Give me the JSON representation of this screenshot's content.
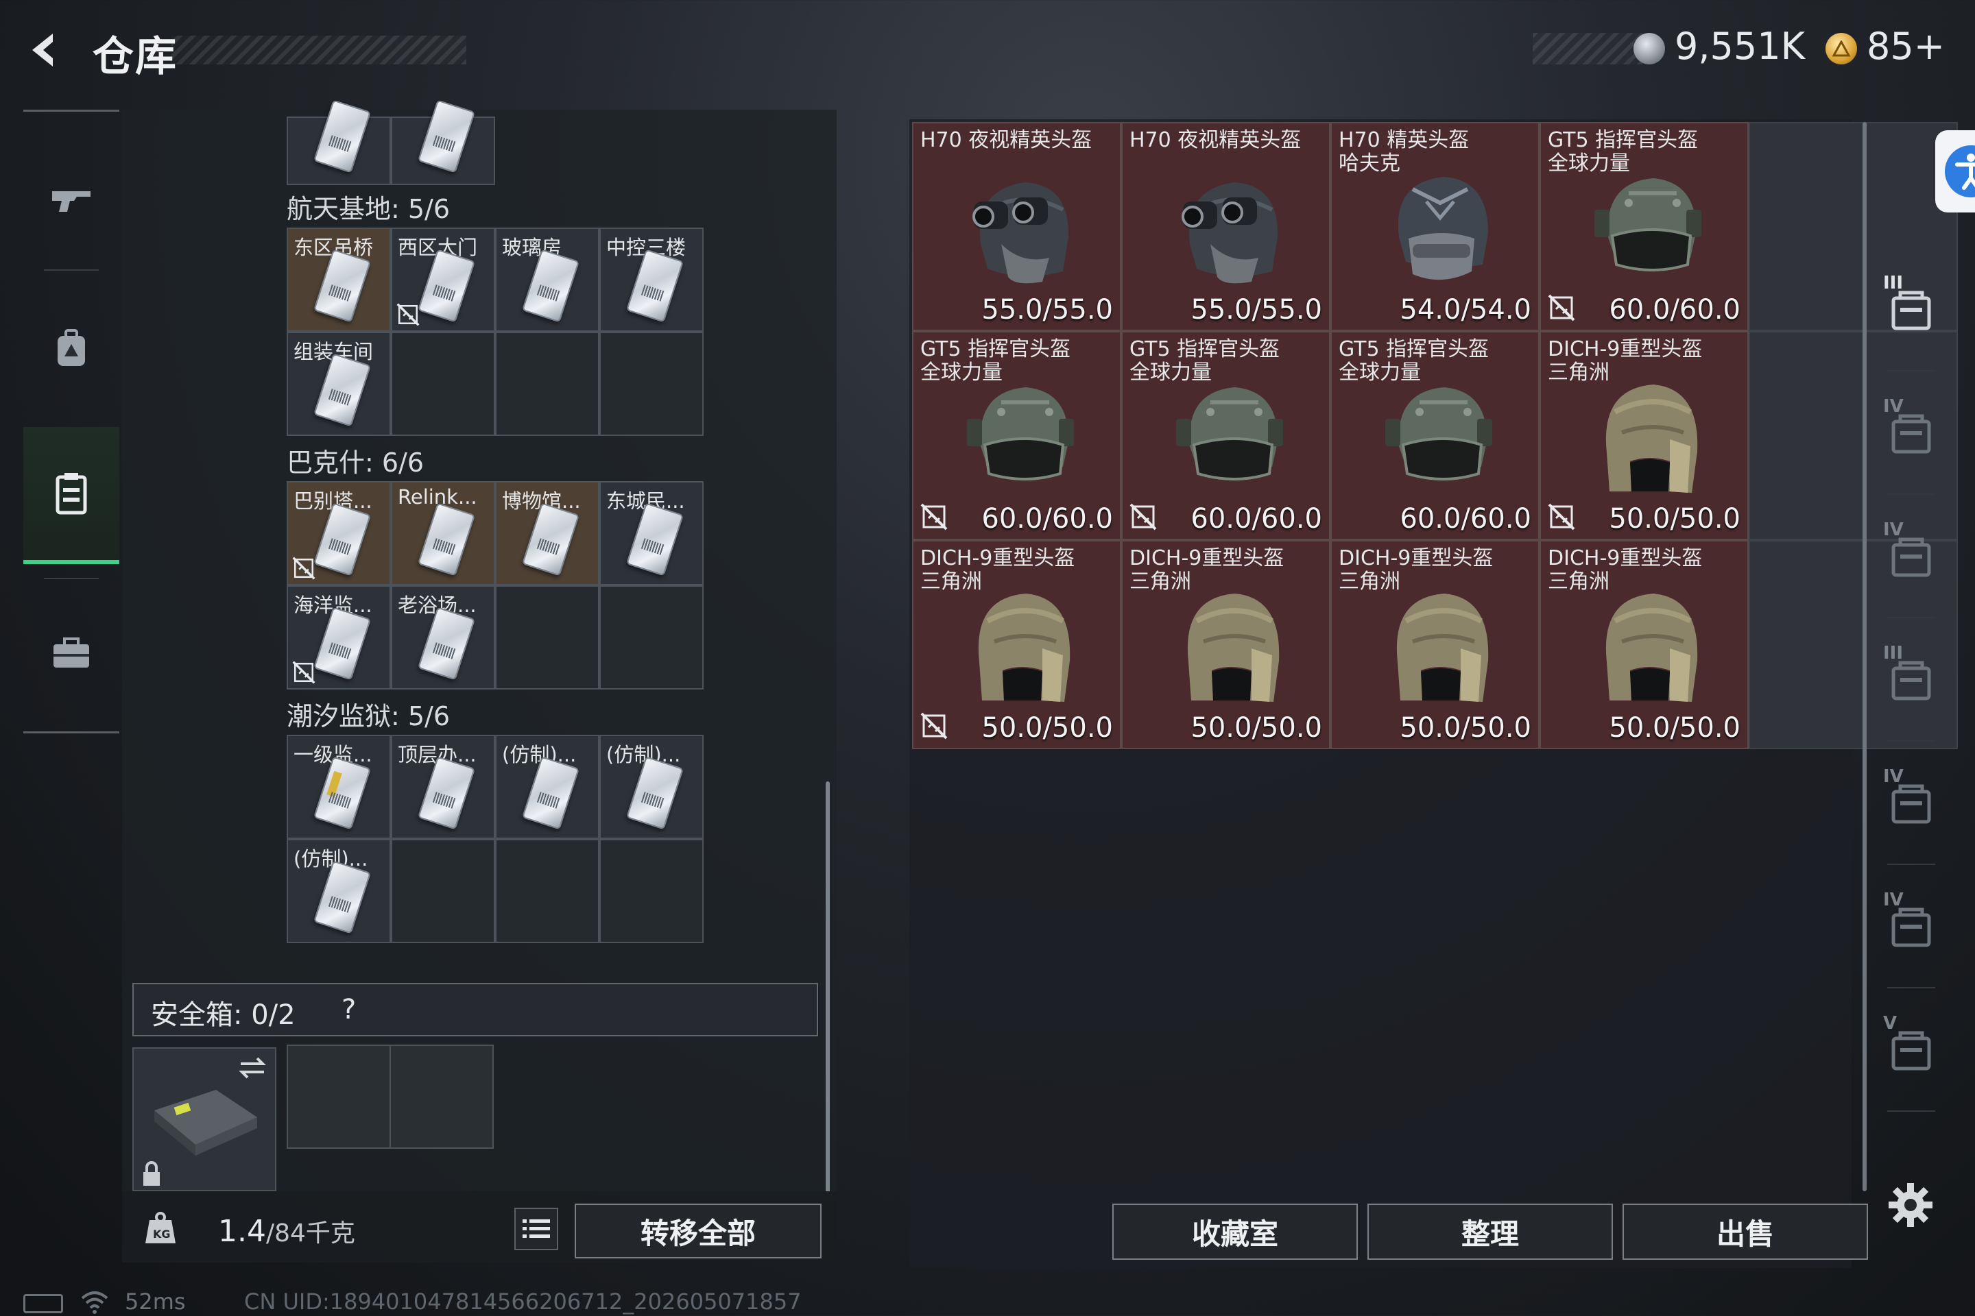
{
  "header": {
    "title": "仓库",
    "currency_silver": "9,551K",
    "currency_gold": "85+"
  },
  "left_nav": {
    "items": [
      "weapons",
      "backpack",
      "warehouse",
      "toolbox"
    ],
    "active": "warehouse"
  },
  "warehouse_list": {
    "top_row_labels": [
      "",
      ""
    ],
    "sections": [
      {
        "title": "航天基地: 5/6",
        "items": [
          {
            "label": "东区吊桥",
            "no_link": false,
            "highlight": true
          },
          {
            "label": "西区大门",
            "no_link": true,
            "highlight": false
          },
          {
            "label": "玻璃房",
            "no_link": false,
            "highlight": false
          },
          {
            "label": "中控三楼",
            "no_link": false,
            "highlight": false
          },
          {
            "label": "组装车间",
            "no_link": false,
            "highlight": false
          }
        ]
      },
      {
        "title": "巴克什: 6/6",
        "items": [
          {
            "label": "巴别塔...",
            "no_link": true,
            "highlight": true
          },
          {
            "label": "Relink...",
            "no_link": false,
            "highlight": true
          },
          {
            "label": "博物馆...",
            "no_link": false,
            "highlight": true
          },
          {
            "label": "东城民...",
            "no_link": false,
            "highlight": false
          },
          {
            "label": "海洋监...",
            "no_link": true,
            "highlight": false
          },
          {
            "label": "老浴场...",
            "no_link": false,
            "highlight": false
          }
        ]
      },
      {
        "title": "潮汐监狱: 5/6",
        "items": [
          {
            "label": "一级监...",
            "no_link": false,
            "highlight": false,
            "gold": true
          },
          {
            "label": "顶层办...",
            "no_link": false,
            "highlight": false
          },
          {
            "label": "(仿制)...",
            "no_link": false,
            "highlight": false
          },
          {
            "label": "(仿制)...",
            "no_link": false,
            "highlight": false
          },
          {
            "label": "(仿制)...",
            "no_link": false,
            "highlight": false
          }
        ]
      }
    ]
  },
  "safe_box": {
    "label": "安全箱:",
    "count": "0/2",
    "help": "?"
  },
  "bottom_left": {
    "weight_value": "1.4",
    "weight_max": "/84千克",
    "transfer_all": "转移全部"
  },
  "helmets": [
    {
      "name_line1": "H70 夜视精英头盔",
      "name_line2": "",
      "durability": "55.0/55.0",
      "no_link": false,
      "type": "nv"
    },
    {
      "name_line1": "H70 夜视精英头盔",
      "name_line2": "",
      "durability": "55.0/55.0",
      "no_link": false,
      "type": "nv"
    },
    {
      "name_line1": "H70 精英头盔",
      "name_line2": "哈夫克",
      "durability": "54.0/54.0",
      "no_link": false,
      "type": "elite"
    },
    {
      "name_line1": "GT5 指挥官头盔",
      "name_line2": "全球力量",
      "durability": "60.0/60.0",
      "no_link": true,
      "type": "gt5"
    },
    {
      "name_line1": "GT5 指挥官头盔",
      "name_line2": "全球力量",
      "durability": "60.0/60.0",
      "no_link": true,
      "type": "gt5"
    },
    {
      "name_line1": "GT5 指挥官头盔",
      "name_line2": "全球力量",
      "durability": "60.0/60.0",
      "no_link": true,
      "type": "gt5"
    },
    {
      "name_line1": "GT5 指挥官头盔",
      "name_line2": "全球力量",
      "durability": "60.0/60.0",
      "no_link": false,
      "type": "gt5"
    },
    {
      "name_line1": "DICH-9重型头盔",
      "name_line2": "三角洲",
      "durability": "50.0/50.0",
      "no_link": true,
      "type": "dich"
    },
    {
      "name_line1": "DICH-9重型头盔",
      "name_line2": "三角洲",
      "durability": "50.0/50.0",
      "no_link": true,
      "type": "dich"
    },
    {
      "name_line1": "DICH-9重型头盔",
      "name_line2": "三角洲",
      "durability": "50.0/50.0",
      "no_link": false,
      "type": "dich"
    },
    {
      "name_line1": "DICH-9重型头盔",
      "name_line2": "三角洲",
      "durability": "50.0/50.0",
      "no_link": false,
      "type": "dich"
    },
    {
      "name_line1": "DICH-9重型头盔",
      "name_line2": "三角洲",
      "durability": "50.0/50.0",
      "no_link": false,
      "type": "dich"
    }
  ],
  "right_actions": {
    "collection": "收藏室",
    "organize": "整理",
    "sell": "出售"
  },
  "right_nav": {
    "tiers": [
      "III",
      "IV",
      "IV",
      "III",
      "IV",
      "IV",
      "V"
    ]
  },
  "footer": {
    "ping": "52ms",
    "uid": "CN UID:189401047814566206712_202605071857"
  },
  "colors": {
    "accent_green": "#3fd18a",
    "item_bg_red": "#4a2a2c",
    "highlight_brown": "#4e4134",
    "access_blue": "#2f7de1"
  }
}
